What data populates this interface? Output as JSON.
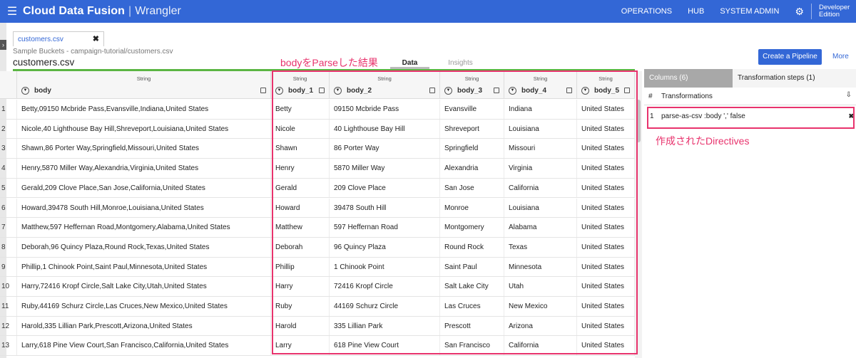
{
  "app": {
    "brand": "Cloud Data Fusion",
    "separator": "|",
    "module": "Wrangler"
  },
  "nav": {
    "operations": "OPERATIONS",
    "hub": "HUB",
    "system_admin": "SYSTEM ADMIN",
    "edition_line1": "Developer",
    "edition_line2": "Edition"
  },
  "file_tab": {
    "name": "customers.csv",
    "close": "✖"
  },
  "breadcrumb": "Sample Buckets - campaign-tutorial/customers.csv",
  "file_title": "customers.csv",
  "view_tabs": [
    "Data",
    "Insights"
  ],
  "actions": {
    "create_pipeline": "Create a Pipeline",
    "more": "More"
  },
  "annotations": {
    "parse_result": "bodyをParseした結果",
    "directives": "作成されたDirectives"
  },
  "columns": [
    {
      "name": "body",
      "type": "String"
    },
    {
      "name": "body_1",
      "type": "String"
    },
    {
      "name": "body_2",
      "type": "String"
    },
    {
      "name": "body_3",
      "type": "String"
    },
    {
      "name": "body_4",
      "type": "String"
    },
    {
      "name": "body_5",
      "type": "String"
    }
  ],
  "rows": [
    {
      "n": "1",
      "cells": [
        "Betty,09150 Mcbride Pass,Evansville,Indiana,United States",
        "Betty",
        "09150 Mcbride Pass",
        "Evansville",
        "Indiana",
        "United States"
      ]
    },
    {
      "n": "2",
      "cells": [
        "Nicole,40 Lighthouse Bay Hill,Shreveport,Louisiana,United States",
        "Nicole",
        "40 Lighthouse Bay Hill",
        "Shreveport",
        "Louisiana",
        "United States"
      ]
    },
    {
      "n": "3",
      "cells": [
        "Shawn,86 Porter Way,Springfield,Missouri,United States",
        "Shawn",
        "86 Porter Way",
        "Springfield",
        "Missouri",
        "United States"
      ]
    },
    {
      "n": "4",
      "cells": [
        "Henry,5870 Miller Way,Alexandria,Virginia,United States",
        "Henry",
        "5870 Miller Way",
        "Alexandria",
        "Virginia",
        "United States"
      ]
    },
    {
      "n": "5",
      "cells": [
        "Gerald,209 Clove Place,San Jose,California,United States",
        "Gerald",
        "209 Clove Place",
        "San Jose",
        "California",
        "United States"
      ]
    },
    {
      "n": "6",
      "cells": [
        "Howard,39478 South Hill,Monroe,Louisiana,United States",
        "Howard",
        "39478 South Hill",
        "Monroe",
        "Louisiana",
        "United States"
      ]
    },
    {
      "n": "7",
      "cells": [
        "Matthew,597 Heffernan Road,Montgomery,Alabama,United States",
        "Matthew",
        "597 Heffernan Road",
        "Montgomery",
        "Alabama",
        "United States"
      ]
    },
    {
      "n": "8",
      "cells": [
        "Deborah,96 Quincy Plaza,Round Rock,Texas,United States",
        "Deborah",
        "96 Quincy Plaza",
        "Round Rock",
        "Texas",
        "United States"
      ]
    },
    {
      "n": "9",
      "cells": [
        "Phillip,1 Chinook Point,Saint Paul,Minnesota,United States",
        "Phillip",
        "1 Chinook Point",
        "Saint Paul",
        "Minnesota",
        "United States"
      ]
    },
    {
      "n": "10",
      "cells": [
        "Harry,72416 Kropf Circle,Salt Lake City,Utah,United States",
        "Harry",
        "72416 Kropf Circle",
        "Salt Lake City",
        "Utah",
        "United States"
      ]
    },
    {
      "n": "11",
      "cells": [
        "Ruby,44169 Schurz Circle,Las Cruces,New Mexico,United States",
        "Ruby",
        "44169 Schurz Circle",
        "Las Cruces",
        "New Mexico",
        "United States"
      ]
    },
    {
      "n": "12",
      "cells": [
        "Harold,335 Lillian Park,Prescott,Arizona,United States",
        "Harold",
        "335 Lillian Park",
        "Prescott",
        "Arizona",
        "United States"
      ]
    },
    {
      "n": "13",
      "cells": [
        "Larry,618 Pine View Court,San Francisco,California,United States",
        "Larry",
        "618 Pine View Court",
        "San Francisco",
        "California",
        "United States"
      ]
    }
  ],
  "right_panel": {
    "tab_columns": "Columns (6)",
    "tab_steps": "Transformation steps (1)",
    "header_hash": "#",
    "header_title": "Transformations",
    "steps": [
      {
        "n": "1",
        "directive": "parse-as-csv :body ',' false"
      }
    ]
  },
  "colors": {
    "brand": "#3367d6",
    "accent": "#e8336d",
    "progress": "#5bb543"
  }
}
